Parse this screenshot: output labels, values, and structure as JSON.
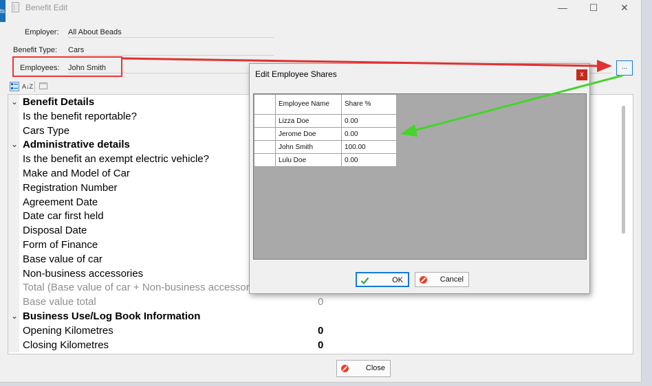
{
  "window": {
    "title": "Benefit Edit",
    "taskbar_fragment": "ts",
    "controls": {
      "minimize": "—",
      "maximize": "☐",
      "close": "✕"
    }
  },
  "form": {
    "employer_label": "Employer:",
    "employer_value": "All About Beads",
    "benefit_type_label": "Benefit Type:",
    "benefit_type_value": "Cars",
    "employees_label": "Employees:",
    "employees_value": "John  Smith",
    "ellipsis_label": "..."
  },
  "toolbar": {
    "categorized_icon": "categorized-icon",
    "alphabetical_label": "A↓Z",
    "pages_icon": "property-pages-icon"
  },
  "property_grid": {
    "rows": [
      {
        "type": "category",
        "label": "Benefit Details",
        "value": ""
      },
      {
        "type": "item",
        "label": "Is the benefit reportable?",
        "value": ""
      },
      {
        "type": "item",
        "label": "Cars Type",
        "value": ""
      },
      {
        "type": "category",
        "label": "Administrative details",
        "value": ""
      },
      {
        "type": "item",
        "label": "Is the benefit an exempt electric vehicle?",
        "value": ""
      },
      {
        "type": "item",
        "label": "Make and Model of Car",
        "value": ""
      },
      {
        "type": "item",
        "label": "Registration Number",
        "value": ""
      },
      {
        "type": "item",
        "label": "Agreement Date",
        "value": ""
      },
      {
        "type": "item",
        "label": "Date car first held",
        "value": ""
      },
      {
        "type": "item",
        "label": "Disposal Date",
        "value": ""
      },
      {
        "type": "item",
        "label": "Form of Finance",
        "value": ""
      },
      {
        "type": "item",
        "label": "Base value of car",
        "value": ""
      },
      {
        "type": "item",
        "label": "Non-business accessories",
        "value": ""
      },
      {
        "type": "readonly",
        "label": "Total (Base value of car + Non-business accessories)",
        "value": ""
      },
      {
        "type": "readonly",
        "label": "Base value total",
        "value": "0"
      },
      {
        "type": "category",
        "label": "Business Use/Log Book Information",
        "value": ""
      },
      {
        "type": "item",
        "label": "Opening Kilometres",
        "value": "0"
      },
      {
        "type": "item",
        "label": "Closing Kilometres",
        "value": "0"
      }
    ]
  },
  "dialog": {
    "title": "Edit Employee Shares",
    "close_glyph": "x",
    "columns": [
      "Employee Name",
      "Share %"
    ],
    "rows": [
      {
        "name": "Lizza Doe",
        "share": "0.00"
      },
      {
        "name": "Jerome Doe",
        "share": "0.00"
      },
      {
        "name": "John  Smith",
        "share": "100.00"
      },
      {
        "name": "Lulu Doe",
        "share": "0.00"
      }
    ],
    "ok_label": "OK",
    "cancel_label": "Cancel"
  },
  "footer": {
    "close_label": "Close"
  },
  "annotations": {
    "red_color": "#e33030",
    "green_color": "#44d42a"
  }
}
